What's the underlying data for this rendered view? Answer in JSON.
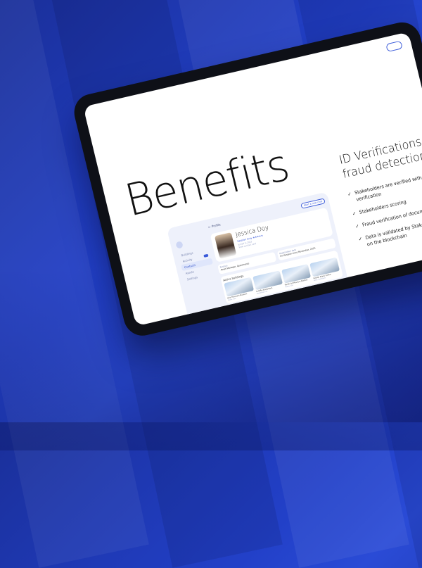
{
  "slide": {
    "title": "Benefits"
  },
  "section": {
    "title": "ID Verifications and fraud detection",
    "bullets": [
      "Stakeholders are verified with a KYB and ID verification",
      "Stakeholders scoring",
      "Fraud verification of documents",
      "Data is validated by Stakeholders before being stored on the blockchain"
    ],
    "bullet_icon": "check-icon"
  },
  "app": {
    "header": {
      "back_label": "Profile",
      "action_label": "Start a new chat"
    },
    "sidebar": {
      "items": [
        {
          "label": "Buildings",
          "active": false,
          "badge": false
        },
        {
          "label": "Activity",
          "active": false,
          "badge": true
        },
        {
          "label": "Contacts",
          "active": true,
          "badge": false
        },
        {
          "label": "Assets",
          "active": false,
          "badge": false
        },
        {
          "label": "Settings",
          "active": false,
          "badge": false
        }
      ]
    },
    "profile": {
      "name": "Jessica Doy",
      "rating_label": "Kaspian Grey ★★★★★",
      "meta_line1": "Joined in 2023",
      "meta_line2": "View contact card"
    },
    "info": [
      {
        "label": "Position",
        "value": "Asset Manager, Apartments"
      },
      {
        "label": "Registration date",
        "value": "On Kaspian since November, 2023"
      }
    ],
    "buildings_title": "Active buildings",
    "buildings": [
      {
        "name": "One Thousand Museum",
        "sub": "Miami, USA"
      },
      {
        "name": "Schiffle Amsterdam",
        "sub": "Amsterdam, NL"
      },
      {
        "name": "Pacific Art Museum Pavilion",
        "sub": "Miami, USA"
      },
      {
        "name": "Heydar Aliyev Center",
        "sub": "Baku, Azerbaijan"
      }
    ]
  },
  "colors": {
    "background": "#2240c8",
    "accent": "#3a5ad9",
    "device": "#0e1017"
  }
}
